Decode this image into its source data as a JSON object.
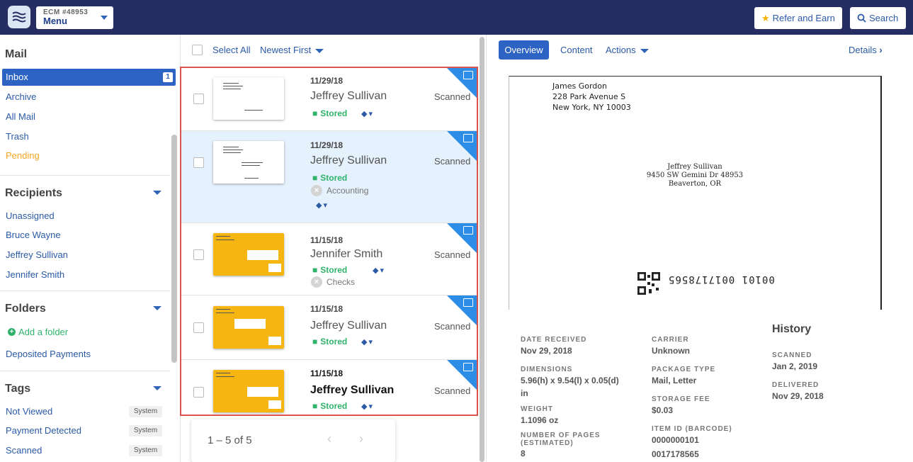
{
  "header": {
    "account_id": "ECM #48953",
    "menu_label": "Menu",
    "refer_label": "Refer and Earn",
    "search_label": "Search"
  },
  "sidebar": {
    "mail_title": "Mail",
    "mail_items": [
      {
        "label": "Inbox",
        "count": "1"
      },
      {
        "label": "Archive"
      },
      {
        "label": "All Mail"
      },
      {
        "label": "Trash"
      },
      {
        "label": "Pending"
      }
    ],
    "recipients_title": "Recipients",
    "recipients": [
      "Unassigned",
      "Bruce Wayne",
      "Jeffrey Sullivan",
      "Jennifer Smith"
    ],
    "folders_title": "Folders",
    "add_folder": "Add a folder",
    "folders": [
      "Deposited Payments"
    ],
    "tags_title": "Tags",
    "tags": [
      {
        "label": "Not Viewed",
        "badge": "System"
      },
      {
        "label": "Payment Detected",
        "badge": "System"
      },
      {
        "label": "Scanned",
        "badge": "System"
      }
    ]
  },
  "list": {
    "select_all": "Select All",
    "sort": "Newest First",
    "items": [
      {
        "date": "11/29/18",
        "name": "Jeffrey Sullivan",
        "status": "Scanned",
        "folder": "Stored",
        "tag": ""
      },
      {
        "date": "11/29/18",
        "name": "Jeffrey Sullivan",
        "status": "Scanned",
        "folder": "Stored",
        "tag": "Accounting"
      },
      {
        "date": "11/15/18",
        "name": "Jennifer Smith",
        "status": "Scanned",
        "folder": "Stored",
        "tag": "Checks"
      },
      {
        "date": "11/15/18",
        "name": "Jeffrey Sullivan",
        "status": "Scanned",
        "folder": "Stored",
        "tag": ""
      },
      {
        "date": "11/15/18",
        "name": "Jeffrey Sullivan",
        "status": "Scanned",
        "folder": "Stored",
        "tag": ""
      }
    ],
    "pagination": "1 – 5 of 5"
  },
  "detail": {
    "tabs": [
      "Overview",
      "Content",
      "Actions"
    ],
    "details_link": "Details",
    "envelope": {
      "sender": [
        "James Gordon",
        "228 Park Avenue S",
        "New York, NY 10003"
      ],
      "recipient": [
        "Jeffrey Sullivan",
        "9450 SW Gemini Dr 48953",
        "Beaverton, OR"
      ],
      "barcode": "00101 0017178565"
    },
    "meta": {
      "date_received_label": "DATE RECEIVED",
      "date_received": "Nov 29, 2018",
      "carrier_label": "CARRIER",
      "carrier": "Unknown",
      "dimensions_label": "DIMENSIONS",
      "dimensions": "5.96(h) x 9.54(l) x 0.05(d) in",
      "package_type_label": "PACKAGE TYPE",
      "package_type": "Mail, Letter",
      "weight_label": "WEIGHT",
      "weight": "1.1096 oz",
      "storage_fee_label": "STORAGE FEE",
      "storage_fee": "$0.03",
      "pages_label": "NUMBER OF PAGES (ESTIMATED)",
      "pages": "8",
      "item_id_label": "ITEM ID (BARCODE)",
      "item_id": "0000000101",
      "item_id_2": "0017178565"
    },
    "history": {
      "title": "History",
      "scanned_label": "SCANNED",
      "scanned": "Jan 2, 2019",
      "delivered_label": "DELIVERED",
      "delivered": "Nov 29, 2018"
    }
  },
  "colors": {
    "topbar": "#252d63",
    "accent": "#2d63c2",
    "stored": "#2fb36b",
    "pending": "#f5a623",
    "selection_border": "#d9534f"
  }
}
